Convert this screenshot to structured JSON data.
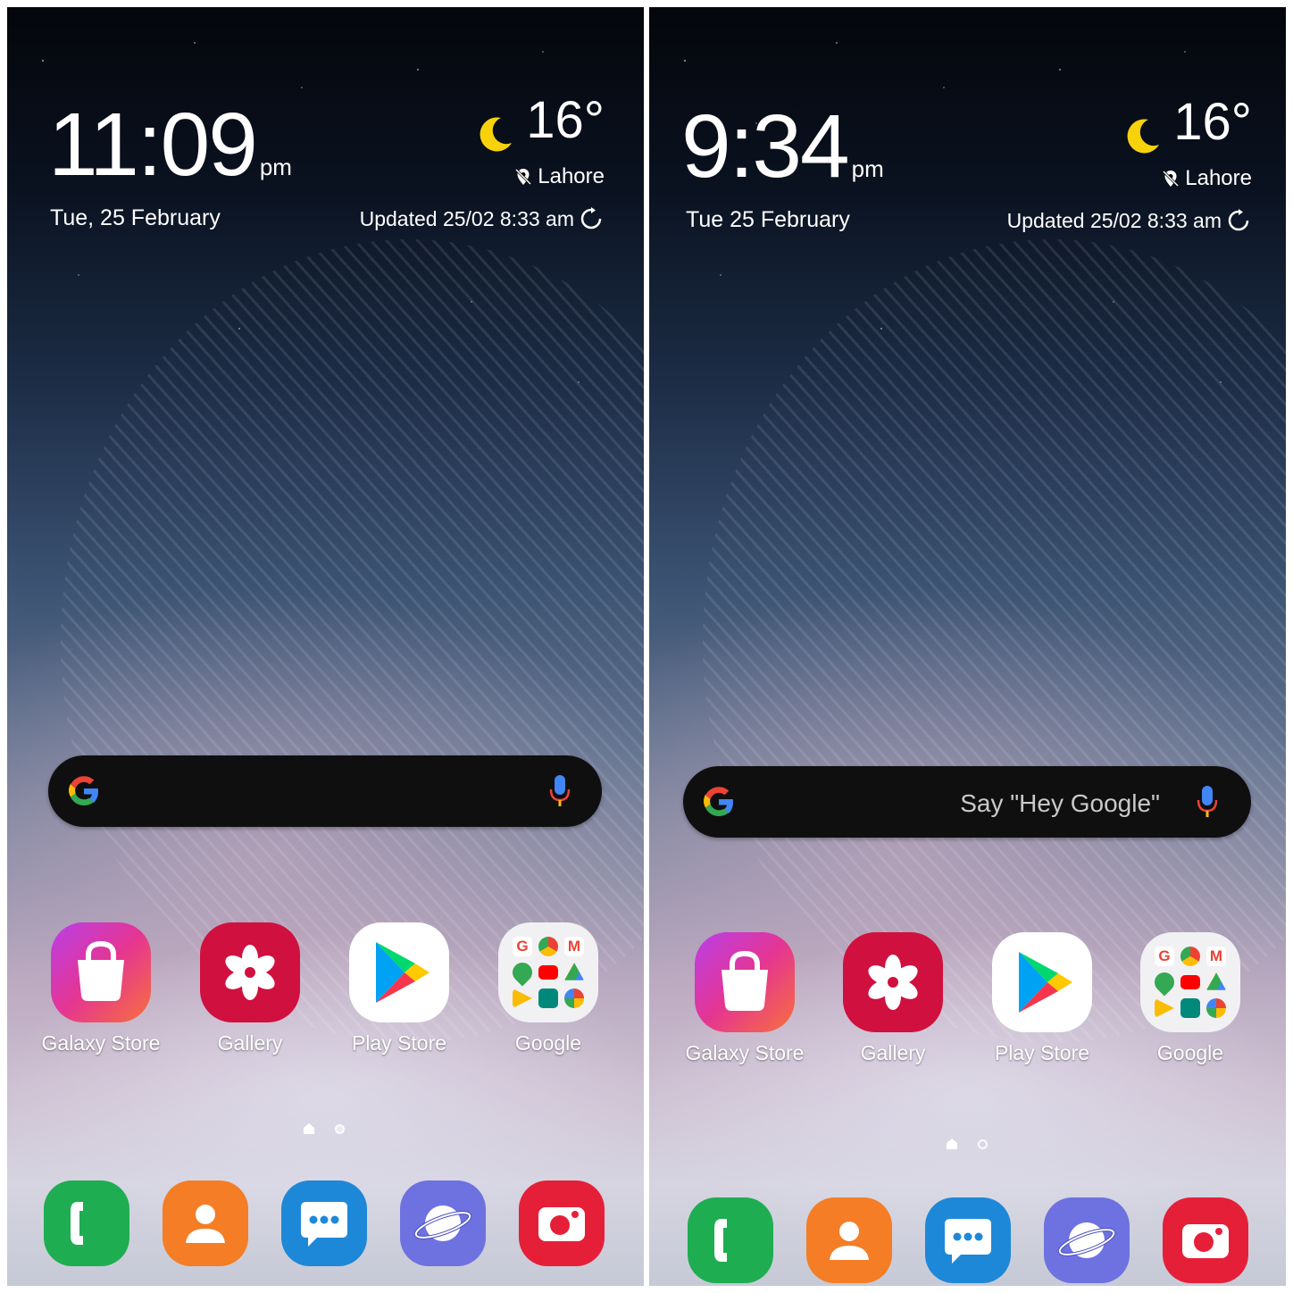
{
  "left": {
    "time": "11:09",
    "ampm": "pm",
    "date": "Tue, 25 February",
    "temperature": "16°",
    "city": "Lahore",
    "updated": "Updated 25/02 8:33 am",
    "search_hint": "",
    "apps": [
      "Galaxy Store",
      "Gallery",
      "Play Store",
      "Google"
    ]
  },
  "right": {
    "time": "9:34",
    "ampm": "pm",
    "date": "Tue 25 February",
    "temperature": "16°",
    "city": "Lahore",
    "updated": "Updated 25/02 8:33 am",
    "search_hint": "Say \"Hey Google\"",
    "apps": [
      "Galaxy Store",
      "Gallery",
      "Play Store",
      "Google"
    ]
  },
  "dock": [
    "phone-icon",
    "contacts-icon",
    "messages-icon",
    "internet-icon",
    "camera-icon"
  ],
  "colors": {
    "galaxy_store": "#e53592",
    "gallery": "#d0103f",
    "phone": "#1fad52",
    "contacts": "#f47d25",
    "messages": "#1e88d8",
    "internet": "#6d72e0",
    "camera": "#e61f38",
    "moon": "#f7d20a"
  }
}
